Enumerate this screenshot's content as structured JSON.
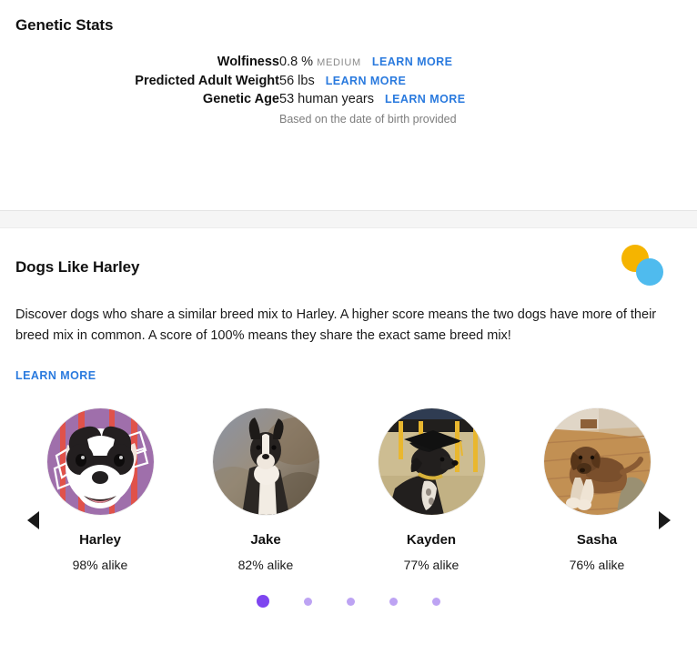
{
  "genetic_stats": {
    "title": "Genetic Stats",
    "rows": [
      {
        "label": "Wolfiness",
        "value": "0.8 %",
        "qualifier": "MEDIUM",
        "learn_more": "LEARN MORE",
        "note": ""
      },
      {
        "label": "Predicted Adult Weight",
        "value": "56 lbs",
        "qualifier": "",
        "learn_more": "LEARN MORE",
        "note": ""
      },
      {
        "label": "Genetic Age",
        "value": "53 human years",
        "qualifier": "",
        "learn_more": "LEARN MORE",
        "note": "Based on the date of birth provided"
      }
    ]
  },
  "dogs_like": {
    "title": "Dogs Like Harley",
    "description": "Discover dogs who share a similar breed mix to Harley. A higher score means the two dogs have more of their breed mix in common. A score of 100% means they share the exact same breed mix!",
    "learn_more": "LEARN MORE",
    "venn_icon": {
      "name": "venn-diagram-icon",
      "yellow": "#f5b400",
      "blue": "#4fbbee",
      "overlap": "#6dbe2a"
    },
    "prev_arrow": "◀",
    "next_arrow": "▶",
    "dogs": [
      {
        "name": "Harley",
        "score": "98% alike",
        "photo": "black-and-white-dog-on-purple-background"
      },
      {
        "name": "Jake",
        "score": "82% alike",
        "photo": "black-and-white-dog-outdoors-on-rocks"
      },
      {
        "name": "Kayden",
        "score": "77% alike",
        "photo": "black-dog-wearing-graduation-cap"
      },
      {
        "name": "Sasha",
        "score": "76% alike",
        "photo": "brown-dog-lying-on-wood-floor"
      }
    ],
    "pagination": {
      "total": 5,
      "active_index": 0,
      "active_color": "#7e45f0",
      "inactive_color": "#bda3f3"
    }
  },
  "colors": {
    "link": "#2a7ade",
    "divider_band": "#f5f5f5",
    "text": "#1a1a1a",
    "muted": "#7d7d7d"
  }
}
